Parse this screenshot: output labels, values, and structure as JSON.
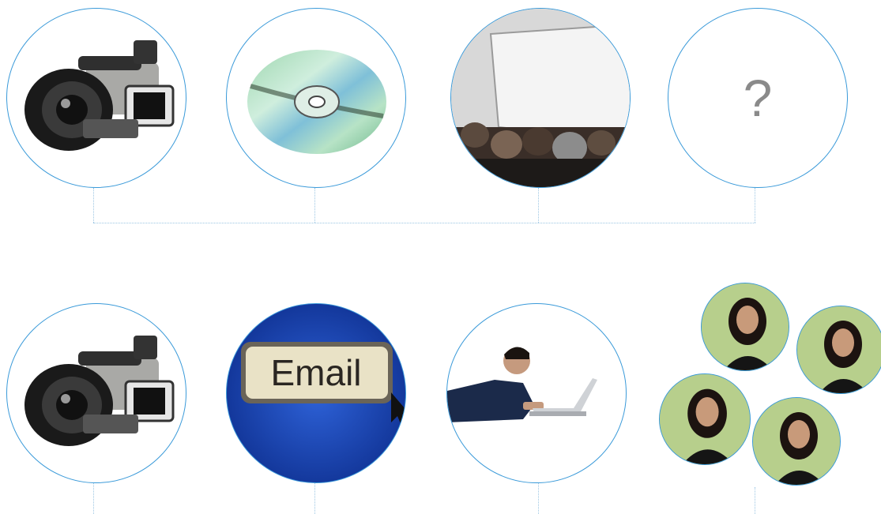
{
  "row1": {
    "items": [
      {
        "icon": "camcorder-icon"
      },
      {
        "icon": "dvd-disc-icon"
      },
      {
        "icon": "presentation-screen-icon"
      },
      {
        "icon": "question-mark-icon",
        "label": "?"
      }
    ]
  },
  "row2": {
    "items": [
      {
        "icon": "camcorder-icon"
      },
      {
        "icon": "email-key-icon",
        "label": "Email"
      },
      {
        "icon": "man-with-laptop-icon"
      },
      {
        "icon": "audience-women-icon",
        "count": 4
      }
    ]
  },
  "colors": {
    "circle_border": "#3a9ad9",
    "connector": "#9cc6e3",
    "email_bg": "#1f4ec0"
  }
}
